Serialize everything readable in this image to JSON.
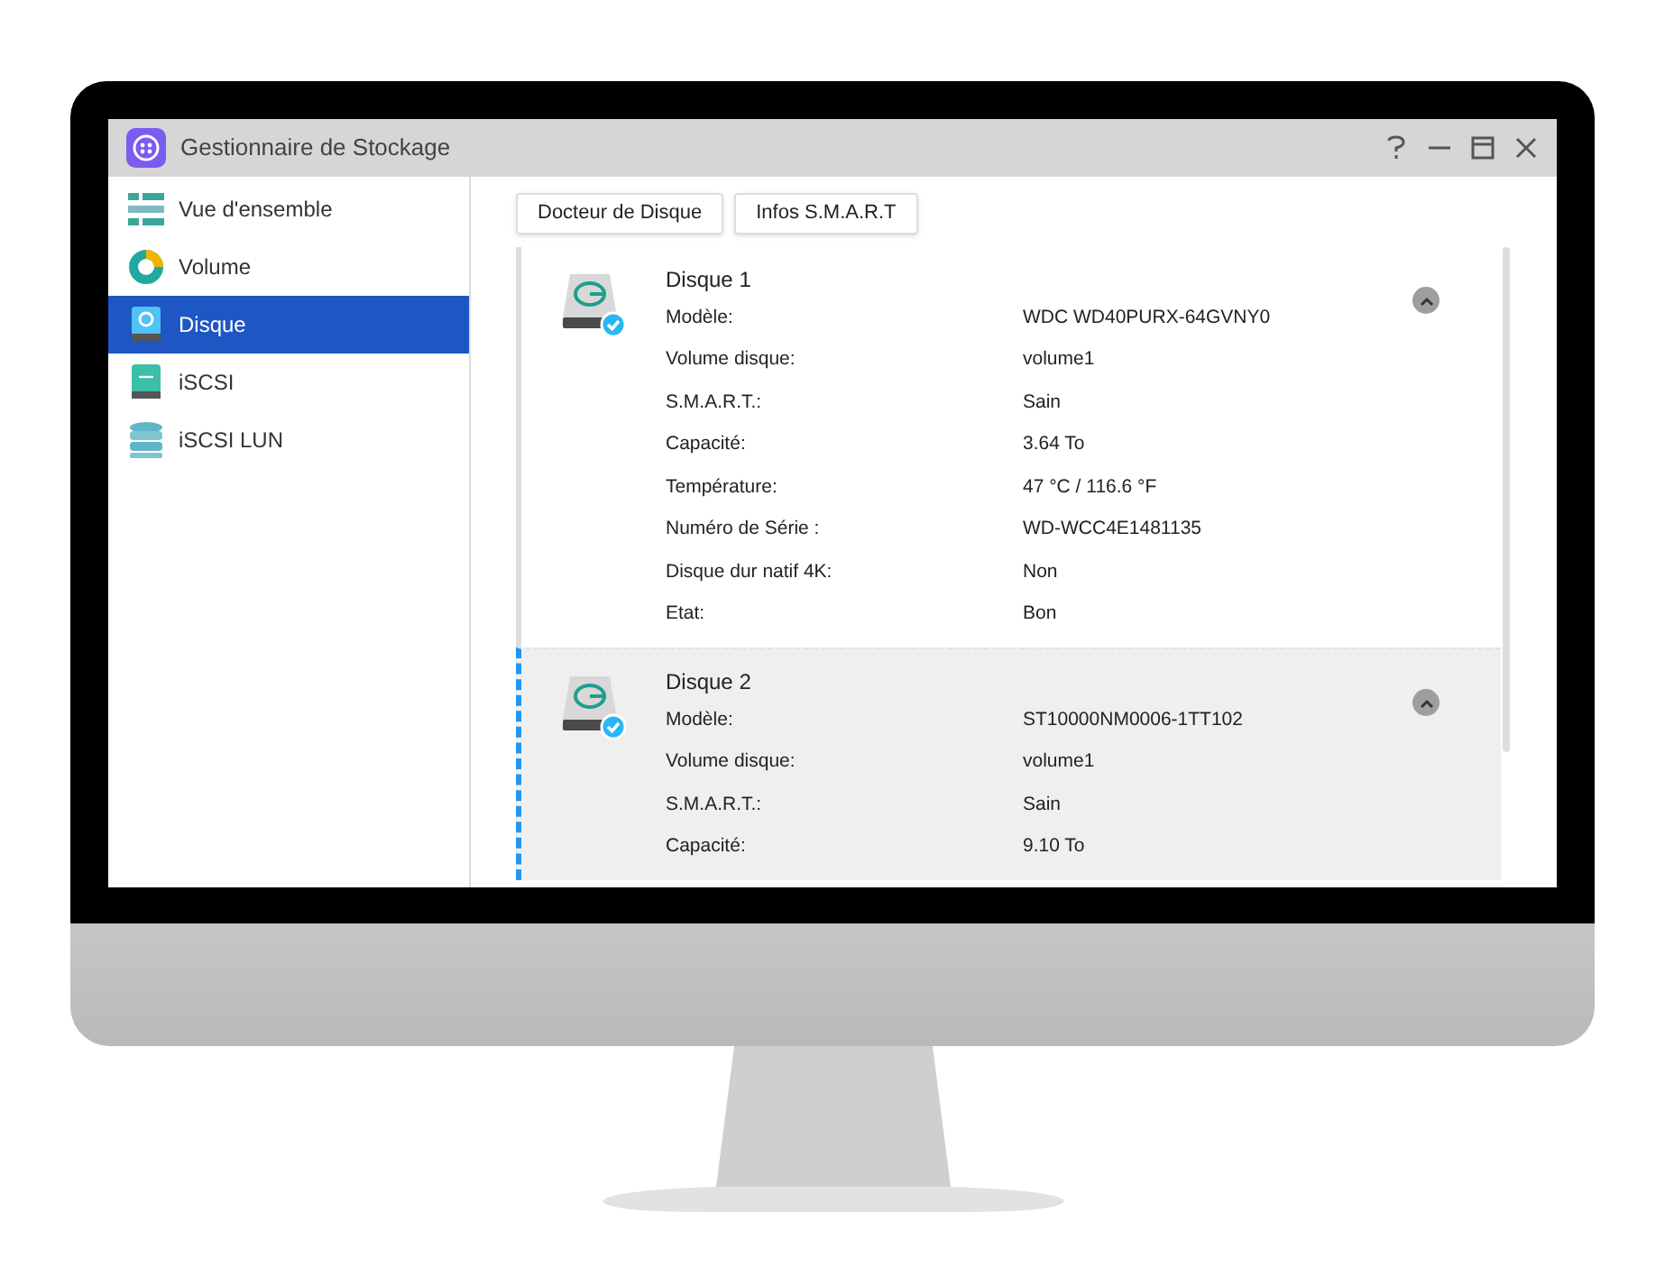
{
  "window": {
    "title": "Gestionnaire de Stockage"
  },
  "sidebar": {
    "items": [
      {
        "label": "Vue d'ensemble",
        "kind": "overview",
        "selected": false
      },
      {
        "label": "Volume",
        "kind": "volume",
        "selected": false
      },
      {
        "label": "Disque",
        "kind": "disk",
        "selected": true
      },
      {
        "label": "iSCSI",
        "kind": "iscsi",
        "selected": false
      },
      {
        "label": "iSCSI LUN",
        "kind": "lun",
        "selected": false
      }
    ]
  },
  "toolbar": {
    "buttons": [
      "Docteur de Disque",
      "Infos S.M.A.R.T"
    ]
  },
  "disks": [
    {
      "name": "Disque 1",
      "selected": false,
      "expanded": true,
      "fields": [
        {
          "label": "Modèle:",
          "value": "WDC WD40PURX-64GVNY0"
        },
        {
          "label": "Volume disque:",
          "value": "volume1"
        },
        {
          "label": "S.M.A.R.T.:",
          "value": "Sain"
        },
        {
          "label": "Capacité:",
          "value": "3.64 To"
        },
        {
          "label": "Température:",
          "value": "47 °C / 116.6 °F"
        },
        {
          "label": "Numéro de Série :",
          "value": "WD-WCC4E1481135"
        },
        {
          "label": "Disque dur natif 4K:",
          "value": "Non"
        },
        {
          "label": "Etat:",
          "value": "Bon"
        }
      ]
    },
    {
      "name": "Disque 2",
      "selected": true,
      "expanded": true,
      "fields": [
        {
          "label": "Modèle:",
          "value": "ST10000NM0006-1TT102"
        },
        {
          "label": "Volume disque:",
          "value": "volume1"
        },
        {
          "label": "S.M.A.R.T.:",
          "value": "Sain"
        },
        {
          "label": "Capacité:",
          "value": "9.10 To"
        }
      ]
    }
  ]
}
